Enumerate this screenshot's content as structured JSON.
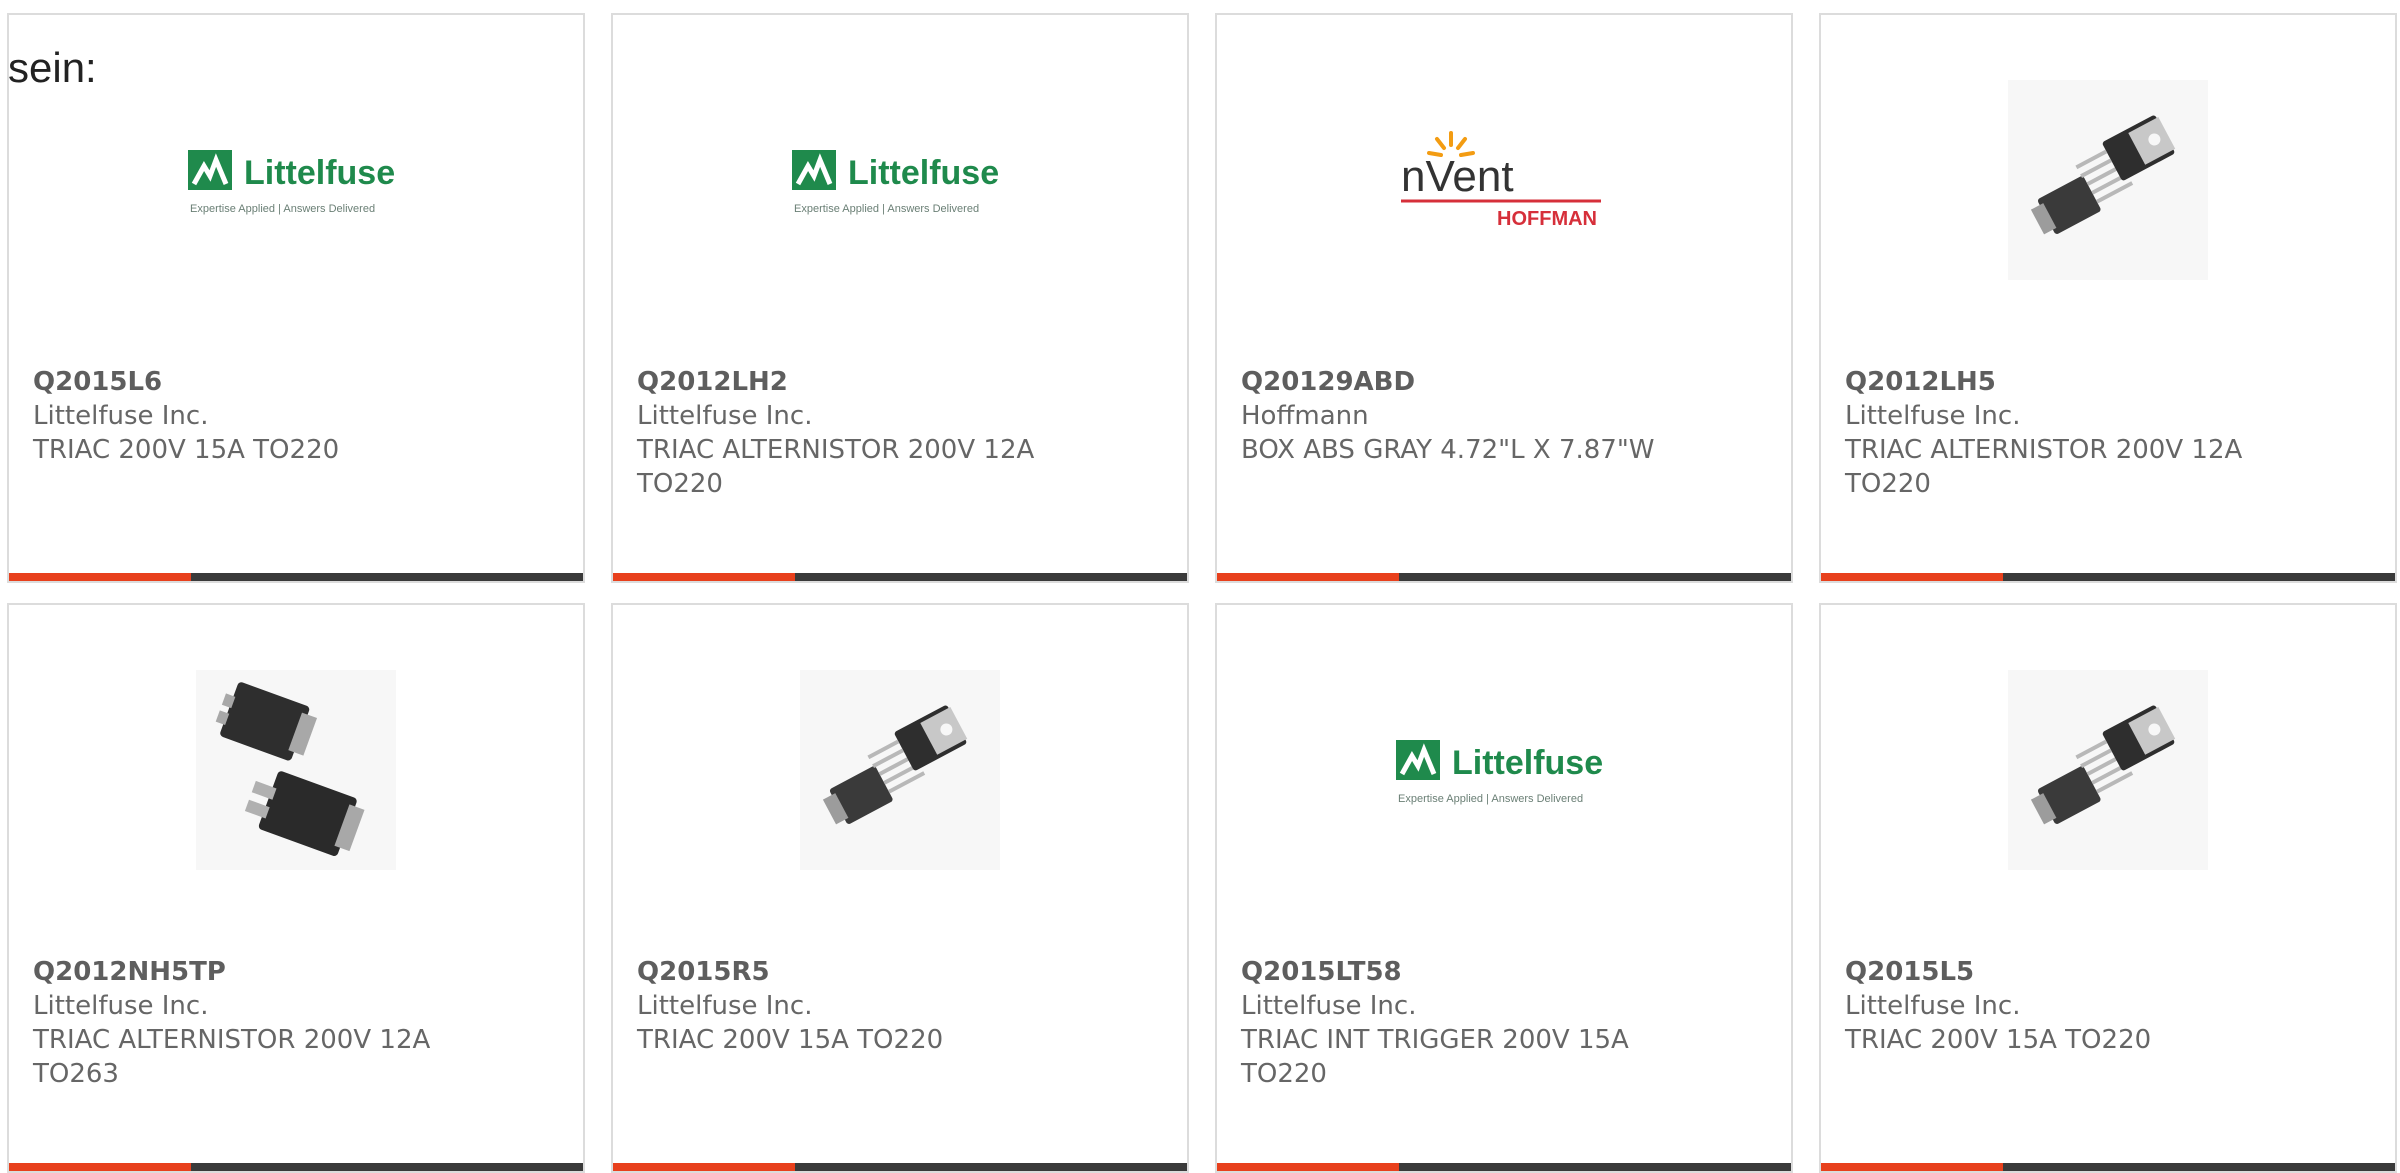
{
  "intro_text": "sein:",
  "colors": {
    "accent": "#e8401c",
    "bar": "#3a3a3a",
    "littelfuse_green": "#1f8a4c",
    "hoffman_red": "#d62f3a"
  },
  "logos": {
    "littelfuse": {
      "name": "Littelfuse",
      "tagline": "Expertise Applied | Answers Delivered"
    },
    "nvent": {
      "name": "nVent",
      "sub": "HOFFMAN"
    }
  },
  "products": [
    {
      "part": "Q2015L6",
      "mfr": "Littelfuse Inc.",
      "desc": "TRIAC 200V 15A TO220",
      "image": "littelfuse-logo"
    },
    {
      "part": "Q2012LH2",
      "mfr": "Littelfuse Inc.",
      "desc": "TRIAC ALTERNISTOR 200V 12A TO220",
      "image": "littelfuse-logo"
    },
    {
      "part": "Q20129ABD",
      "mfr": "Hoffmann",
      "desc": "BOX ABS GRAY 4.72\"L X 7.87\"W",
      "image": "nvent-hoffman-logo"
    },
    {
      "part": "Q2012LH5",
      "mfr": "Littelfuse Inc.",
      "desc": "TRIAC ALTERNISTOR 200V 12A TO220",
      "image": "to220-package-photo"
    },
    {
      "part": "Q2012NH5TP",
      "mfr": "Littelfuse Inc.",
      "desc": "TRIAC ALTERNISTOR 200V 12A TO263",
      "image": "to263-package-photo"
    },
    {
      "part": "Q2015R5",
      "mfr": "Littelfuse Inc.",
      "desc": "TRIAC 200V 15A TO220",
      "image": "to220-package-photo"
    },
    {
      "part": "Q2015LT58",
      "mfr": "Littelfuse Inc.",
      "desc": "TRIAC INT TRIGGER 200V 15A TO220",
      "image": "littelfuse-logo"
    },
    {
      "part": "Q2015L5",
      "mfr": "Littelfuse Inc.",
      "desc": "TRIAC 200V 15A TO220",
      "image": "to220-package-photo"
    }
  ]
}
